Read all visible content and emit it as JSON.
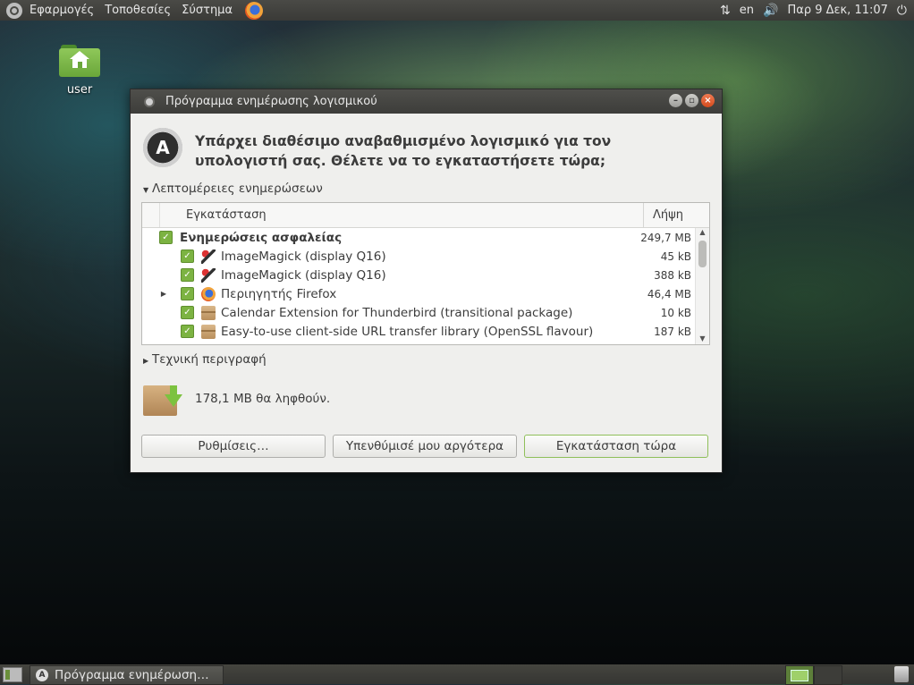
{
  "top_panel": {
    "menus": [
      "Εφαρμογές",
      "Τοποθεσίες",
      "Σύστημα"
    ],
    "lang": "en",
    "datetime": "Παρ  9 Δεκ, 11:07"
  },
  "desktop": {
    "home_label": "user"
  },
  "dialog": {
    "title": "Πρόγραμμα ενημέρωσης λογισμικού",
    "headline": "Υπάρχει διαθέσιμο αναβαθμισμένο λογισμικό για τον υπολογιστή σας. Θέλετε να το εγκαταστήσετε τώρα;",
    "details_expander": "Λεπτομέρειες ενημερώσεων",
    "columns": {
      "install": "Εγκατάσταση",
      "download": "Λήψη"
    },
    "rows": [
      {
        "name": "Ενημερώσεις ασφαλείας",
        "size": "249,7 MB",
        "icon": "none",
        "group": true
      },
      {
        "name": "ImageMagick (display Q16)",
        "size": "45 kB",
        "icon": "imagemagick-icon"
      },
      {
        "name": "ImageMagick (display Q16)",
        "size": "388 kB",
        "icon": "imagemagick-icon"
      },
      {
        "name": "Περιηγητής Firefox",
        "size": "46,4 MB",
        "icon": "firefox-icon",
        "expandable": true
      },
      {
        "name": "Calendar Extension for Thunderbird (transitional package)",
        "size": "10 kB",
        "icon": "package-icon"
      },
      {
        "name": "Easy-to-use client-side URL transfer library (OpenSSL flavour)",
        "size": "187 kB",
        "icon": "package-icon"
      }
    ],
    "tech_expander": "Τεχνική περιγραφή",
    "download_summary": "178,1 MB θα ληφθούν.",
    "buttons": {
      "settings": "Ρυθμίσεις…",
      "remind": "Υπενθύμισέ μου αργότερα",
      "install": "Εγκατάσταση τώρα"
    }
  },
  "bottom_panel": {
    "task_label": "Πρόγραμμα ενημέρωση…"
  }
}
